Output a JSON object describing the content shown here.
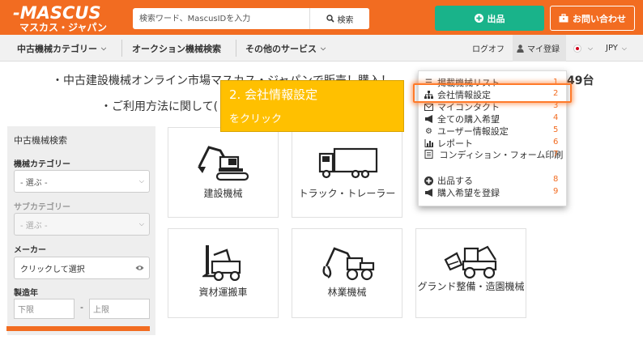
{
  "header": {
    "logo_main": "-MASCUS",
    "logo_sub": "マスカス・ジャパン",
    "search_placeholder": "検索ワード、MascusIDを入力",
    "search_button": "検索",
    "listing_button": "出品",
    "contact_button": "お問い合わせ",
    "colors": {
      "brand": "#f26c21",
      "listing": "#19b38a"
    }
  },
  "nav": {
    "items": [
      "中古機械カテゴリー",
      "オークション機械検索",
      "その他のサービス"
    ],
    "logoff": "ログオフ",
    "my_account": "マイ登録",
    "currency": "JPY"
  },
  "hero": {
    "line1": "・中古建設機械オンライン市場マスカス・ジャパンで販売！購入！",
    "line2": "・ご利用方法に関して(",
    "count_suffix": "49台"
  },
  "search_panel": {
    "title": "中古機械検索",
    "category_label": "機械カテゴリー",
    "category_value": "- 選ぶ -",
    "subcategory_label": "サブカテゴリー",
    "subcategory_value": "- 選ぶ -",
    "maker_label": "メーカー",
    "maker_placeholder": "クリックして選択",
    "year_label": "製造年",
    "year_from": "下限",
    "year_to": "上限",
    "range_sep": "-"
  },
  "categories": [
    {
      "label": "建設機械",
      "icon": "excavator-icon"
    },
    {
      "label": "トラック・トレーラー",
      "icon": "truck-icon"
    },
    {
      "label": "資材運搬車",
      "icon": "forklift-icon"
    },
    {
      "label": "林業機械",
      "icon": "forestry-machine-icon"
    },
    {
      "label": "グランド整備・造園機械",
      "icon": "ground-care-icon"
    }
  ],
  "dropdown": {
    "items": [
      {
        "label": "掲載機械リスト",
        "icon": "list-icon",
        "num": "1"
      },
      {
        "label": "会社情報設定",
        "icon": "org-chart-icon",
        "num": "2"
      },
      {
        "label": "マイコンタクト",
        "icon": "envelope-icon",
        "num": "3"
      },
      {
        "label": "全ての購入希望",
        "icon": "megaphone-icon",
        "num": "4"
      },
      {
        "label": "ユーザー情報設定",
        "icon": "gear-icon",
        "num": "5"
      },
      {
        "label": "レポート",
        "icon": "bar-chart-icon",
        "num": "6"
      },
      {
        "label": "コンディション・フォーム印刷",
        "icon": "document-icon",
        "num": "7"
      },
      {
        "label": "出品する",
        "icon": "plus-circle-icon",
        "num": "8"
      },
      {
        "label": "購入希望を登録",
        "icon": "megaphone-icon",
        "num": "9"
      }
    ]
  },
  "callout": {
    "title": "2.  会社情報設定",
    "subtitle": "をクリック"
  }
}
